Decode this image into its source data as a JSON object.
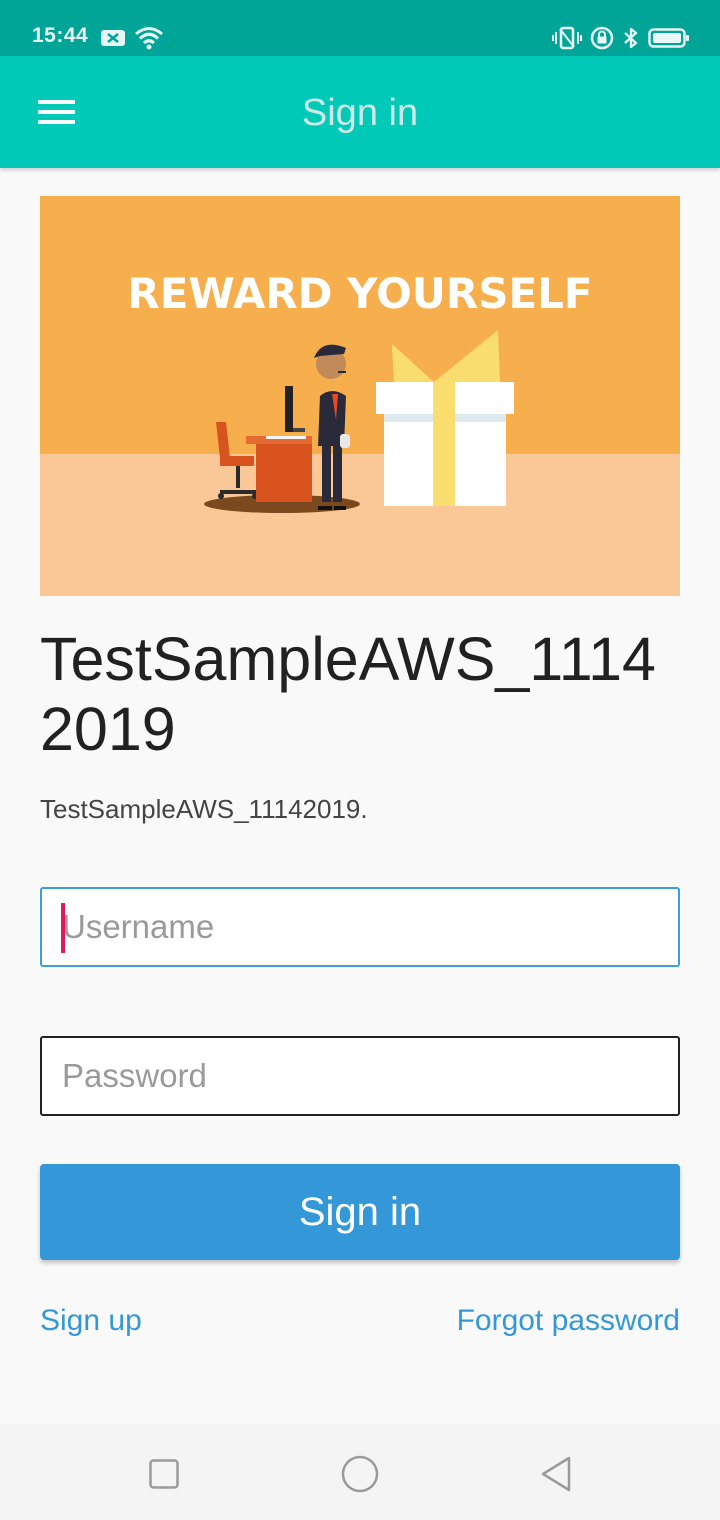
{
  "status_bar": {
    "time": "15:44",
    "left_icons": [
      "message-notification-icon",
      "wifi-icon"
    ],
    "right_icons": [
      "vibrate-icon",
      "rotation-lock-icon",
      "bluetooth-icon",
      "battery-icon"
    ]
  },
  "app_bar": {
    "title": "Sign in",
    "menu_icon": "hamburger-menu-icon"
  },
  "banner": {
    "headline": "REWARD YOURSELF",
    "colors": {
      "top": "#f7ae4c",
      "bottom": "#f9c896"
    }
  },
  "tenant": {
    "title": "TestSampleAWS_11142019",
    "subtitle": "TestSampleAWS_11142019."
  },
  "form": {
    "username": {
      "placeholder": "Username",
      "value": ""
    },
    "password": {
      "placeholder": "Password",
      "value": ""
    },
    "submit_label": "Sign in",
    "signup_label": "Sign up",
    "forgot_label": "Forgot password"
  },
  "nav_bar": {
    "buttons": [
      "recent-apps-icon",
      "home-icon",
      "back-icon"
    ]
  },
  "colors": {
    "status_bar": "#00a597",
    "app_bar": "#00c9b7",
    "primary": "#3498d8",
    "caret": "#e2185b"
  }
}
